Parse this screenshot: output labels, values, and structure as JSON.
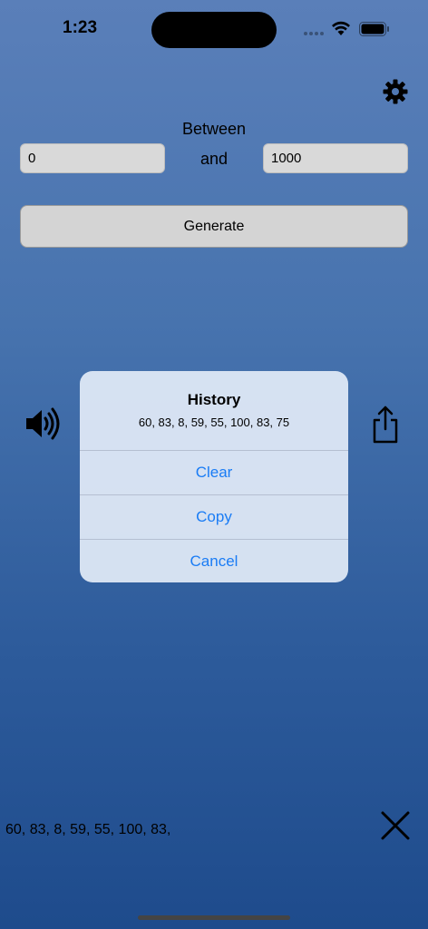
{
  "status_bar": {
    "time": "1:23"
  },
  "range": {
    "between_label": "Between",
    "and_label": "and",
    "min_value": "0",
    "max_value": "1000"
  },
  "generate_label": "Generate",
  "alert": {
    "title": "History",
    "message": "60, 83, 8, 59, 55, 100, 83, 75",
    "actions": {
      "clear": "Clear",
      "copy": "Copy",
      "cancel": "Cancel"
    }
  },
  "history_line": "60, 83, 8, 59, 55, 100, 83,",
  "colors": {
    "accent": "#1a7cf5",
    "background_top": "#5a7fb9",
    "background_bottom": "#1e4b8c"
  },
  "icons": {
    "settings": "gear-icon",
    "sound": "speaker-icon",
    "share": "share-icon",
    "close": "close-icon"
  }
}
